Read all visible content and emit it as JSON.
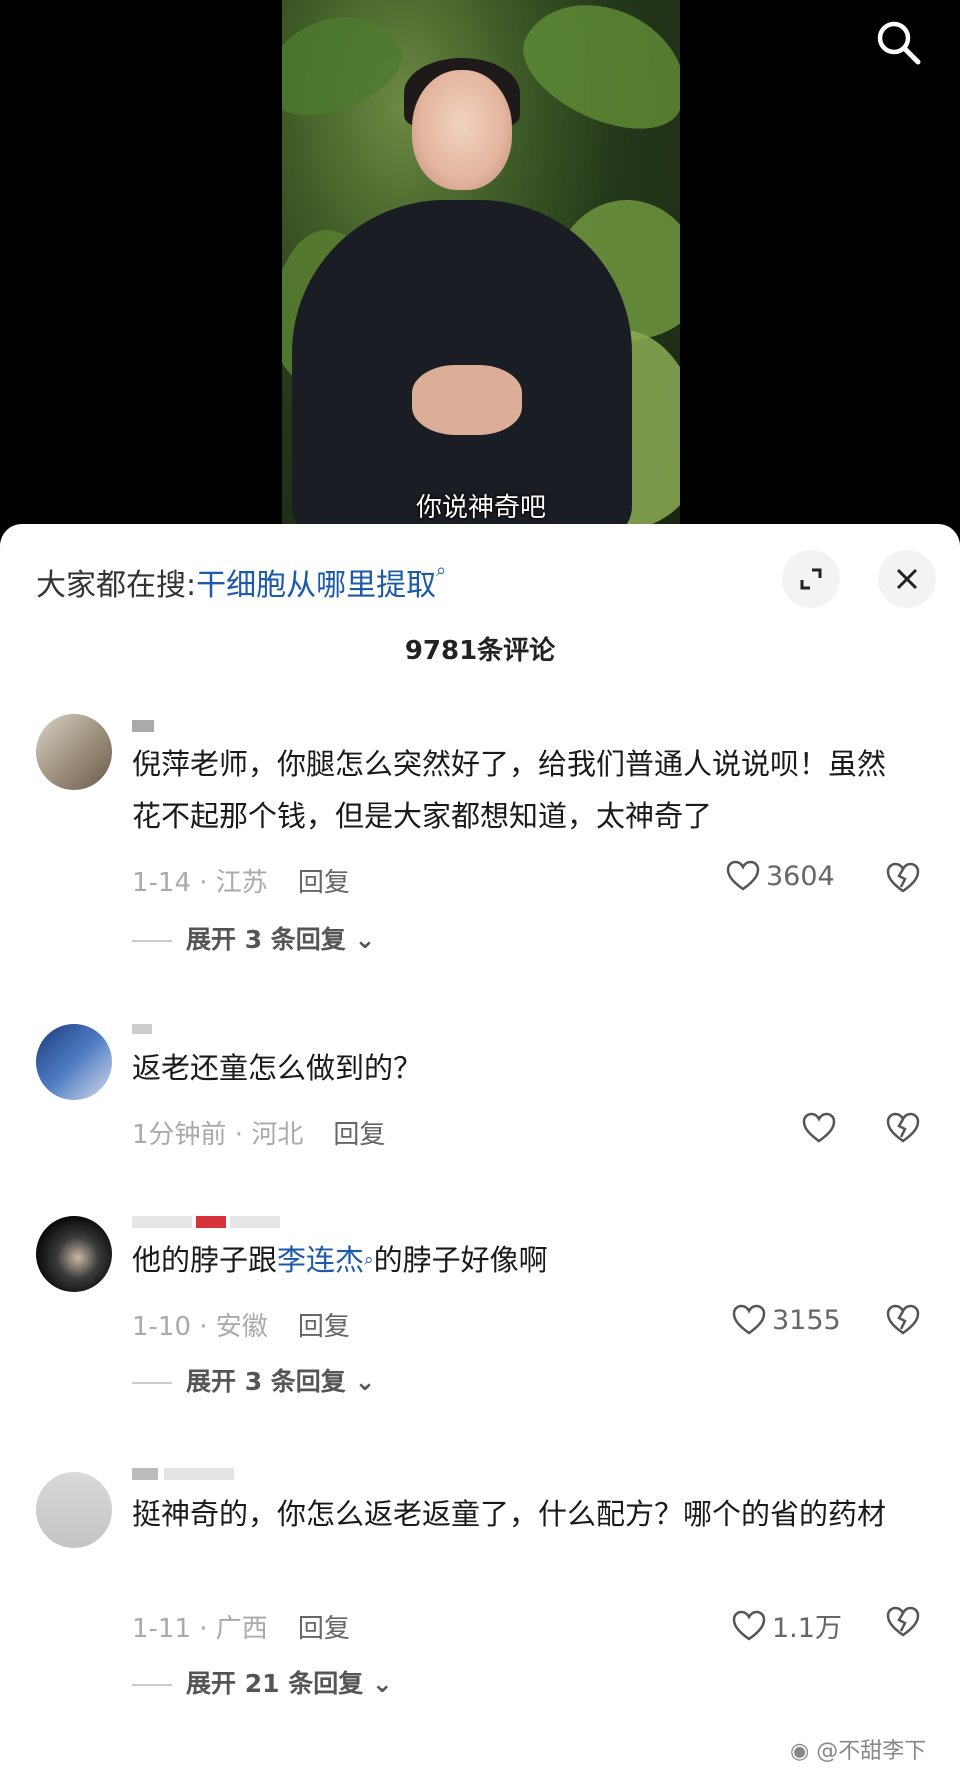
{
  "video": {
    "caption": "你说神奇吧"
  },
  "header": {
    "trending_prefix": "大家都在搜:",
    "trending_keyword": "干细胞从哪里提取"
  },
  "comment_count": "9781条评论",
  "comments": [
    {
      "text": "倪萍老师，你腿怎么突然好了，给我们普通人说说呗！虽然花不起那个钱，但是大家都想知道，太神奇了",
      "meta": "1-14 · 江苏",
      "reply_label": "回复",
      "likes": "3604",
      "expand_label": "展开 3 条回复"
    },
    {
      "text": "返老还童怎么做到的？",
      "meta": "1分钟前 · 河北",
      "reply_label": "回复",
      "likes": ""
    },
    {
      "text_before": "他的脖子跟",
      "text_link": "李连杰",
      "text_after": "的脖子好像啊",
      "meta": "1-10 · 安徽",
      "reply_label": "回复",
      "likes": "3155",
      "expand_label": "展开 3 条回复"
    },
    {
      "text": "挺神奇的，你怎么返老返童了，什么配方？哪个的省的药材",
      "meta": "1-11 · 广西",
      "reply_label": "回复",
      "likes": "1.1万",
      "expand_label": "展开 21 条回复"
    }
  ],
  "watermark": "@不甜李下",
  "colors": {
    "link": "#1d5aa8",
    "sheet_bg": "#ffffff",
    "video_bg": "#000000"
  },
  "icons": [
    "search-icon",
    "search-small-icon",
    "expand-icon",
    "close-icon",
    "heart-icon",
    "broken-heart-icon",
    "chevron-down-icon",
    "weibo-icon"
  ]
}
